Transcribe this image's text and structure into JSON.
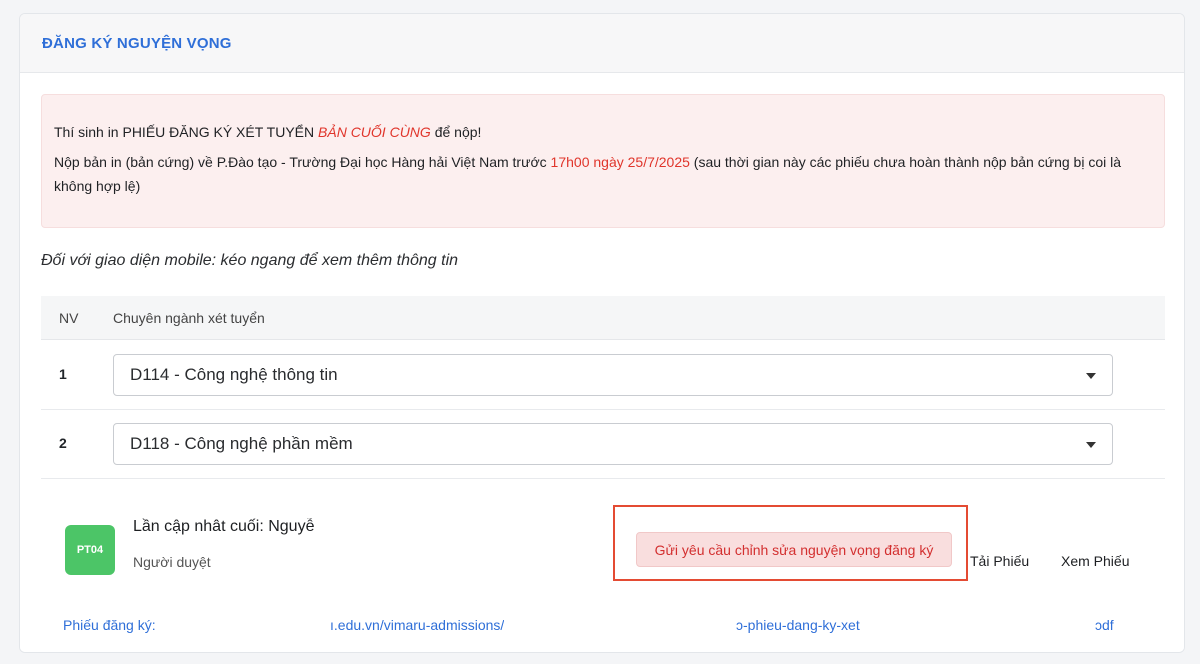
{
  "header": {
    "title": "ĐĂNG KÝ NGUYỆN VỌNG"
  },
  "notice": {
    "line1_prefix": "Thí sinh in PHIẾU ĐĂNG KÝ XÉT TUYỂN ",
    "line1_emphasis": "BẢN CUỐI CÙNG",
    "line1_suffix": " để nộp!",
    "line2_prefix": "Nộp bản in (bản cứng) về P.Đào tạo - Trường Đại học Hàng hải Việt Nam trước ",
    "line2_deadline": "17h00 ngày 25/7/2025",
    "line2_suffix": " (sau thời gian này các phiếu chưa hoàn thành nộp bản cứng bị coi là không hợp lệ)"
  },
  "mobile_note": "Đối với giao diện mobile: kéo ngang để xem thêm thông tin",
  "table": {
    "columns": [
      "NV",
      "Chuyên ngành xét tuyển"
    ],
    "rows": [
      {
        "nv": "1",
        "major": "D114 - Công nghệ thông tin"
      },
      {
        "nv": "2",
        "major": "D118 - Công nghệ phần mềm"
      }
    ]
  },
  "footer": {
    "badge": "PT04",
    "last_updated": "Lần cập nhât cuối: Nguyễ",
    "approver": "Người duyệt",
    "request_button": "Gửi yêu cầu chỉnh sửa nguyện vọng đăng ký",
    "download": "Tải Phiếu",
    "view": "Xem Phiếu",
    "link_label": "Phiếu đăng ký:",
    "link_part1": "ı.edu.vn/vimaru-admissions/",
    "link_part2": "ɔ-phieu-dang-ky-xet",
    "link_part3": "ɔdf"
  },
  "colors": {
    "accent": "#2f6fd8",
    "danger": "#e0352b",
    "badge": "#4cc567",
    "highlight_border": "#e44b33"
  }
}
